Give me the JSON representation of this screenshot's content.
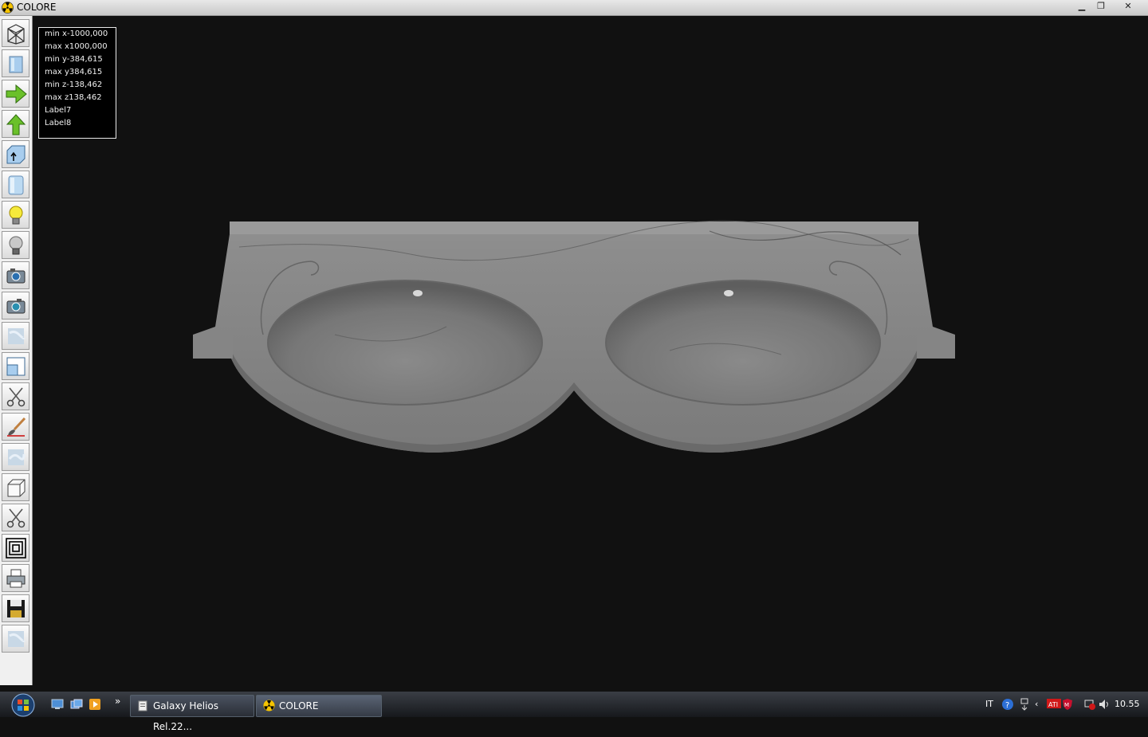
{
  "window": {
    "title": "COLORE",
    "icon": "radiation-icon"
  },
  "info_panel": {
    "lines": [
      "min x-1000,000",
      "max x1000,000",
      "min y-384,615",
      "max y384,615",
      "min z-138,462",
      "max z138,462",
      "Label7",
      "Label8"
    ]
  },
  "toolbar": {
    "tools": [
      "wireframe-icon",
      "box-icon",
      "arrow-right-icon",
      "arrow-up-icon",
      "box-arrow-icon",
      "cylinder-icon",
      "lightbulb-on-icon",
      "lightbulb-off-icon",
      "camera-icon",
      "camera-alt-icon",
      "texture-icon",
      "box-outline-icon",
      "scissors-icon",
      "paint-brush-icon",
      "texture-alt-icon",
      "cube-icon",
      "scissors-alt-icon",
      "concentric-squares-icon",
      "printer-icon",
      "save-icon",
      "texture-disabled-icon"
    ]
  },
  "taskbar": {
    "tasks": [
      {
        "label": "Galaxy Helios  Rel.22...",
        "icon": "document-icon"
      },
      {
        "label": "COLORE",
        "icon": "radiation-icon"
      }
    ],
    "tray": {
      "lang": "IT",
      "clock": "10.55"
    },
    "quick_launch_more": "»"
  },
  "colors": {
    "viewport": "#111111",
    "marble": "#8a8a8a"
  }
}
